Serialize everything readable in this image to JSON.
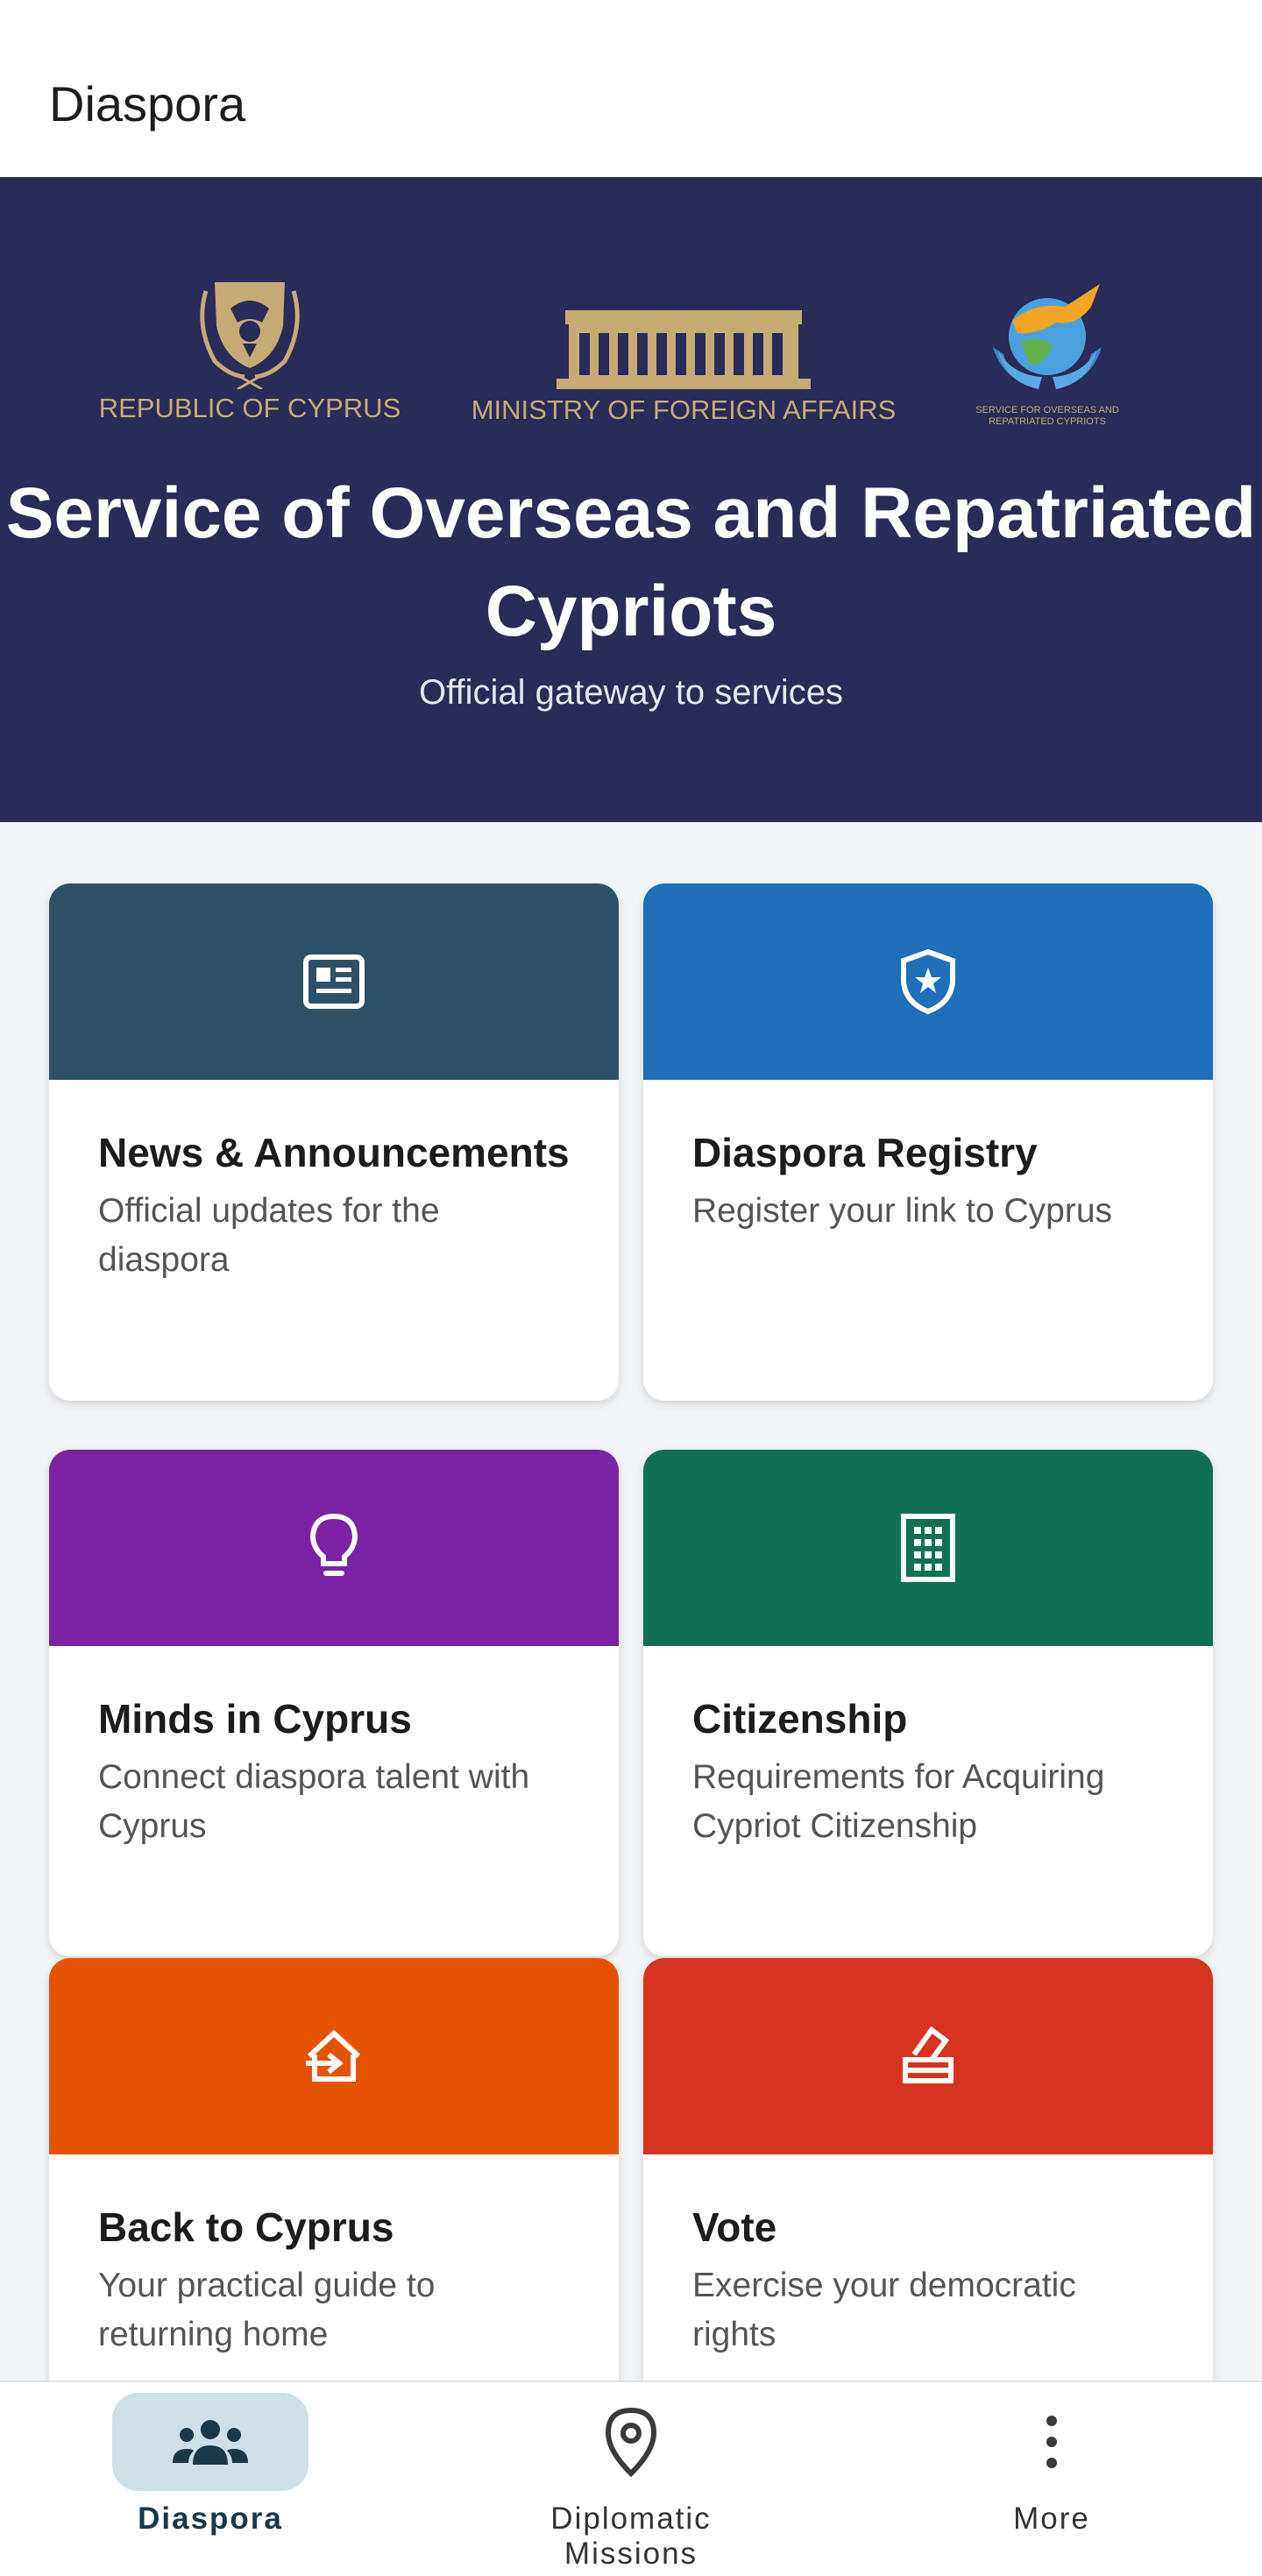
{
  "appbar": {
    "title": "Diaspora"
  },
  "hero": {
    "logos": [
      {
        "label": "REPUBLIC OF CYPRUS",
        "icon": "cyprus-coat-of-arms"
      },
      {
        "label": "MINISTRY OF FOREIGN AFFAIRS",
        "icon": "ministry-building"
      },
      {
        "label": "SERVICE FOR OVERSEAS AND REPATRIATED CYPRIOTS",
        "icon": "globe-hands-logo"
      }
    ],
    "title": "Service of Overseas and Repatriated Cypriots",
    "subtitle": "Official gateway to services"
  },
  "cards": [
    {
      "title": "News & Announcements",
      "description": "Official updates for the diaspora",
      "icon": "newspaper-icon",
      "color": "#2d5166"
    },
    {
      "title": "Diaspora Registry",
      "description": "Register your link to Cyprus",
      "icon": "shield-star-icon",
      "color": "#1e6eb9"
    },
    {
      "title": "Minds in Cyprus",
      "description": "Connect diaspora talent with Cyprus",
      "icon": "lightbulb-icon",
      "color": "#7b22a5"
    },
    {
      "title": "Citizenship",
      "description": "Requirements for Acquiring Cypriot Citizenship",
      "icon": "building-icon",
      "color": "#0f7053"
    },
    {
      "title": "Back to Cyprus",
      "description": "Your practical guide to returning home",
      "icon": "return-home-icon",
      "color": "#e55301"
    },
    {
      "title": "Vote",
      "description": "Exercise your democratic rights",
      "icon": "ballot-box-icon",
      "color": "#d6341f"
    }
  ],
  "nav": {
    "items": [
      {
        "label": "Diaspora",
        "icon": "people-icon",
        "active": true
      },
      {
        "label": "Diplomatic Missions",
        "icon": "location-pin-icon",
        "active": false
      },
      {
        "label": "More",
        "icon": "more-vertical-icon",
        "active": false
      }
    ],
    "active_color": "#cfdfe6",
    "active_text_color": "#19384a"
  }
}
